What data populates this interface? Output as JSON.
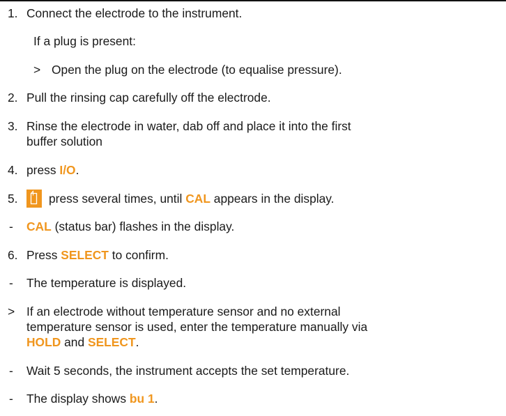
{
  "colors": {
    "accent": "#f0961e",
    "text": "#1a1a1a",
    "rule": "#111111"
  },
  "icons": {
    "key": "soft-key-icon"
  },
  "steps": {
    "s1": {
      "marker": "1.",
      "text": "Connect the electrode to the instrument."
    },
    "s1_note": "If a plug is present:",
    "s1_sub": {
      "marker": ">",
      "text": "Open the plug on the electrode (to equalise pressure)."
    },
    "s2": {
      "marker": "2.",
      "text": "Pull the rinsing cap carefully off the electrode."
    },
    "s3": {
      "marker": "3.",
      "line1": "Rinse the electrode in water, dab off and place it into the first",
      "line2": "buffer solution"
    },
    "s4": {
      "marker": "4.",
      "pre": "press ",
      "key": "I/O",
      "post": "."
    },
    "s5": {
      "marker": "5.",
      "pre": "press several times, until ",
      "key": "CAL",
      "post": " appears in the display."
    },
    "r1": {
      "marker": "-",
      "key": "CAL",
      "post": " (status bar) flashes in the display."
    },
    "s6": {
      "marker": "6.",
      "pre": "Press ",
      "key": "SELECT",
      "post": " to confirm."
    },
    "r2": {
      "marker": "-",
      "text": "The temperature is displayed."
    },
    "a1": {
      "marker": ">",
      "line1": "If an electrode without temperature sensor and no external",
      "line2": "temperature sensor is used, enter the temperature manually via",
      "key1": "HOLD",
      "mid": " and ",
      "key2": "SELECT",
      "post": "."
    },
    "r3": {
      "marker": "-",
      "text": "Wait 5 seconds, the instrument accepts the set temperature."
    },
    "r4": {
      "marker": "-",
      "pre": "The display shows ",
      "key": "bu 1",
      "post": "."
    }
  }
}
